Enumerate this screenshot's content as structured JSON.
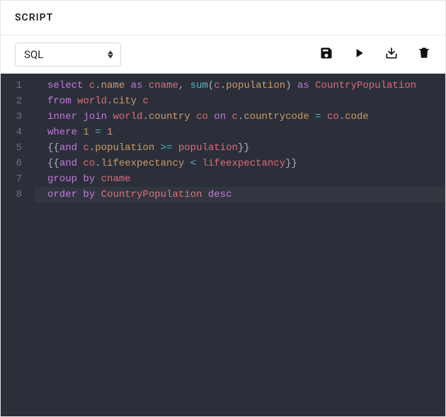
{
  "header": {
    "title": "SCRIPT"
  },
  "toolbar": {
    "language_selected": "SQL",
    "actions": {
      "save": "save",
      "run": "run",
      "download": "download",
      "delete": "delete"
    }
  },
  "editor": {
    "current_line": 8,
    "lines": [
      {
        "n": 1,
        "tokens": [
          {
            "t": "select ",
            "c": "kw"
          },
          {
            "t": "c",
            "c": "id"
          },
          {
            "t": ".",
            "c": "pun"
          },
          {
            "t": "name",
            "c": "prop"
          },
          {
            "t": " ",
            "c": "plain"
          },
          {
            "t": "as ",
            "c": "kw"
          },
          {
            "t": "cname",
            "c": "id"
          },
          {
            "t": ", ",
            "c": "pun"
          },
          {
            "t": "sum",
            "c": "func"
          },
          {
            "t": "(",
            "c": "pun"
          },
          {
            "t": "c",
            "c": "id"
          },
          {
            "t": ".",
            "c": "pun"
          },
          {
            "t": "population",
            "c": "prop"
          },
          {
            "t": ")",
            "c": "pun"
          },
          {
            "t": " ",
            "c": "plain"
          },
          {
            "t": "as ",
            "c": "kw"
          },
          {
            "t": "CountryPopulation",
            "c": "id"
          }
        ]
      },
      {
        "n": 2,
        "tokens": [
          {
            "t": "from ",
            "c": "kw"
          },
          {
            "t": "world",
            "c": "id"
          },
          {
            "t": ".",
            "c": "pun"
          },
          {
            "t": "city",
            "c": "prop"
          },
          {
            "t": " ",
            "c": "plain"
          },
          {
            "t": "c",
            "c": "id"
          }
        ]
      },
      {
        "n": 3,
        "tokens": [
          {
            "t": "inner ",
            "c": "kw"
          },
          {
            "t": "join ",
            "c": "kw"
          },
          {
            "t": "world",
            "c": "id"
          },
          {
            "t": ".",
            "c": "pun"
          },
          {
            "t": "country",
            "c": "prop"
          },
          {
            "t": " ",
            "c": "plain"
          },
          {
            "t": "co",
            "c": "id"
          },
          {
            "t": " ",
            "c": "plain"
          },
          {
            "t": "on ",
            "c": "kw"
          },
          {
            "t": "c",
            "c": "id"
          },
          {
            "t": ".",
            "c": "pun"
          },
          {
            "t": "countrycode",
            "c": "prop"
          },
          {
            "t": " ",
            "c": "plain"
          },
          {
            "t": "=",
            "c": "op"
          },
          {
            "t": " ",
            "c": "plain"
          },
          {
            "t": "co",
            "c": "id"
          },
          {
            "t": ".",
            "c": "pun"
          },
          {
            "t": "code",
            "c": "prop"
          }
        ]
      },
      {
        "n": 4,
        "tokens": [
          {
            "t": "where ",
            "c": "kw"
          },
          {
            "t": "1",
            "c": "num"
          },
          {
            "t": " ",
            "c": "plain"
          },
          {
            "t": "=",
            "c": "op"
          },
          {
            "t": " ",
            "c": "plain"
          },
          {
            "t": "1",
            "c": "num"
          }
        ]
      },
      {
        "n": 5,
        "tokens": [
          {
            "t": "{{",
            "c": "pun"
          },
          {
            "t": "and ",
            "c": "kw"
          },
          {
            "t": "c",
            "c": "id"
          },
          {
            "t": ".",
            "c": "pun"
          },
          {
            "t": "population",
            "c": "prop"
          },
          {
            "t": " ",
            "c": "plain"
          },
          {
            "t": ">=",
            "c": "op"
          },
          {
            "t": " ",
            "c": "plain"
          },
          {
            "t": "population",
            "c": "id"
          },
          {
            "t": "}}",
            "c": "pun"
          }
        ]
      },
      {
        "n": 6,
        "tokens": [
          {
            "t": "{{",
            "c": "pun"
          },
          {
            "t": "and ",
            "c": "kw"
          },
          {
            "t": "co",
            "c": "id"
          },
          {
            "t": ".",
            "c": "pun"
          },
          {
            "t": "lifeexpectancy",
            "c": "prop"
          },
          {
            "t": " ",
            "c": "plain"
          },
          {
            "t": "<",
            "c": "op"
          },
          {
            "t": " ",
            "c": "plain"
          },
          {
            "t": "lifeexpectancy",
            "c": "id"
          },
          {
            "t": "}}",
            "c": "pun"
          }
        ]
      },
      {
        "n": 7,
        "tokens": [
          {
            "t": "group ",
            "c": "kw"
          },
          {
            "t": "by ",
            "c": "kw"
          },
          {
            "t": "cname",
            "c": "id"
          }
        ]
      },
      {
        "n": 8,
        "tokens": [
          {
            "t": "order ",
            "c": "kw"
          },
          {
            "t": "by ",
            "c": "kw"
          },
          {
            "t": "CountryPopulation",
            "c": "id"
          },
          {
            "t": " ",
            "c": "plain"
          },
          {
            "t": "desc",
            "c": "kw"
          }
        ]
      }
    ]
  }
}
